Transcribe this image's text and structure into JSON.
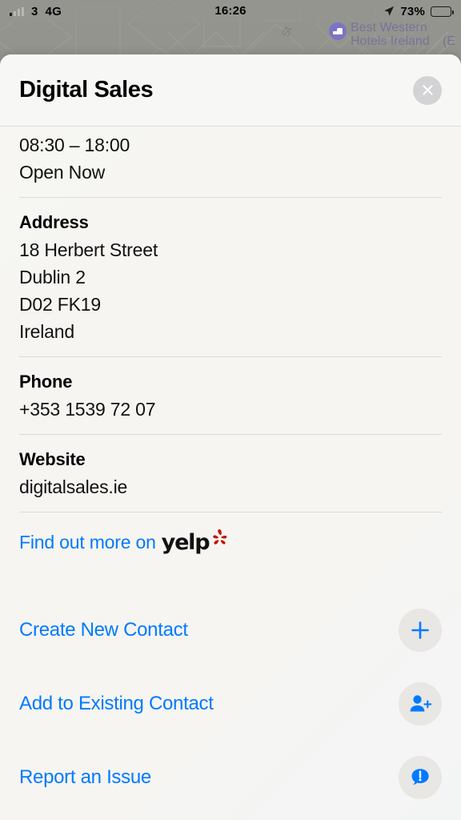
{
  "status_bar": {
    "carrier": "3",
    "network": "4G",
    "time": "16:26",
    "battery_percent": "73%",
    "battery_level": 73,
    "signal_bars_total": 4,
    "signal_bars_filled": 1,
    "location_icon": "location-arrow-icon",
    "battery_icon": "battery-icon"
  },
  "map": {
    "poi_label_line1": "Best Western",
    "poi_label_line2": "Hotels Ireland",
    "poi_icon": "hotel-bed-icon",
    "street_label": "St",
    "edge_label": "(E",
    "poi_color": "#6f6f9c"
  },
  "card": {
    "title": "Digital Sales",
    "close_label": "Close",
    "close_icon": "close-icon"
  },
  "details": {
    "hours": {
      "range": "08:30 – 18:00",
      "status": "Open Now"
    },
    "address": {
      "label": "Address",
      "lines": [
        "18 Herbert Street",
        "Dublin 2",
        "D02 FK19",
        "Ireland"
      ]
    },
    "phone": {
      "label": "Phone",
      "value": "+353 1539 72 07"
    },
    "website": {
      "label": "Website",
      "value": "digitalsales.ie"
    }
  },
  "yelp": {
    "text": "Find out more on",
    "wordmark": "yelp",
    "burst_icon": "yelp-burst-icon",
    "burst_color": "#c41200"
  },
  "actions": [
    {
      "label": "Create New Contact",
      "icon": "plus-icon"
    },
    {
      "label": "Add to Existing Contact",
      "icon": "person-add-icon"
    },
    {
      "label": "Report an Issue",
      "icon": "report-issue-icon"
    }
  ],
  "colors": {
    "accent_blue": "#007AFF",
    "card_bg": "#f7f6f3",
    "divider": "#dadad7",
    "icon_circle": "#e8e7e4"
  }
}
